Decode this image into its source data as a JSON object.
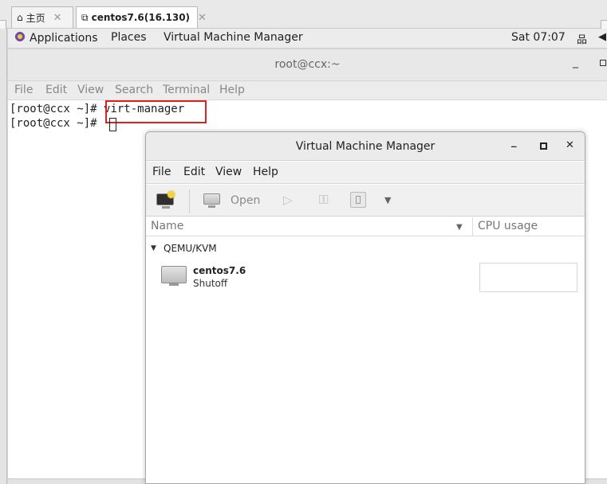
{
  "host_tabs": [
    {
      "label": "主页",
      "icon": "home-icon"
    },
    {
      "label": "centos7.6(16.130)",
      "icon": "vm-console-icon"
    }
  ],
  "topbar": {
    "applications": "Applications",
    "places": "Places",
    "app_name": "Virtual Machine Manager",
    "clock": "Sat 07:07"
  },
  "terminal": {
    "title": "root@ccx:~",
    "menu": [
      "File",
      "Edit",
      "View",
      "Search",
      "Terminal",
      "Help"
    ],
    "lines": [
      {
        "prompt": "[root@ccx ~]# ",
        "command": "virt-manager"
      },
      {
        "prompt": "[root@ccx ~]# ",
        "command": ""
      }
    ]
  },
  "vmm": {
    "title": "Virtual Machine Manager",
    "menu": [
      "File",
      "Edit",
      "View",
      "Help"
    ],
    "toolbar": {
      "open_label": "Open"
    },
    "columns": {
      "name": "Name",
      "cpu": "CPU usage"
    },
    "connection": "QEMU/KVM",
    "vms": [
      {
        "name": "centos7.6",
        "state": "Shutoff"
      }
    ]
  },
  "colors": {
    "highlight": "#e02020",
    "accent": "#6b4ea2"
  }
}
